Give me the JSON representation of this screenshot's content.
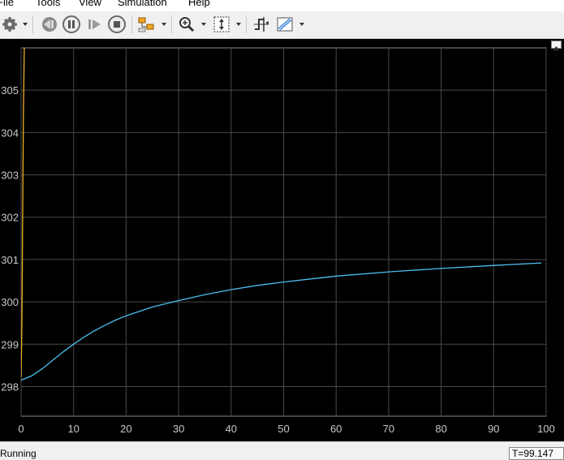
{
  "menu": {
    "items": [
      "File",
      "Tools",
      "View",
      "Simulation",
      "Help"
    ]
  },
  "toolbar": {
    "icons": [
      "settings-icon",
      "step-back-icon",
      "pause-icon",
      "step-forward-icon",
      "stop-icon",
      "highlight-signal-icon",
      "zoom-icon",
      "autoscale-icon",
      "triggers-icon",
      "cursor-measurements-icon"
    ]
  },
  "colors": {
    "background": "#000000",
    "grid": "#4a4a4a",
    "axis_text": "#c8c8c8",
    "series_1": "#4dbeee",
    "series_2": "#edb120"
  },
  "chart_data": {
    "type": "line",
    "title": "",
    "xlabel": "",
    "ylabel": "",
    "xlim": [
      0,
      100
    ],
    "ylim": [
      297.3,
      306
    ],
    "xticks": [
      0,
      10,
      20,
      30,
      40,
      50,
      60,
      70,
      80,
      90,
      100
    ],
    "yticks": [
      298,
      299,
      300,
      301,
      302,
      303,
      304,
      305
    ],
    "grid": true,
    "series": [
      {
        "color": "#4dbeee",
        "x": [
          0,
          2,
          4,
          6,
          8,
          10,
          12,
          14,
          16,
          18,
          20,
          25,
          30,
          35,
          40,
          45,
          50,
          60,
          70,
          80,
          90,
          99.1
        ],
        "y": [
          298.15,
          298.25,
          298.42,
          298.62,
          298.82,
          299.0,
          299.17,
          299.32,
          299.45,
          299.57,
          299.67,
          299.88,
          300.03,
          300.17,
          300.29,
          300.39,
          300.47,
          300.61,
          300.71,
          300.79,
          300.86,
          300.92
        ]
      },
      {
        "color": "#edb120",
        "x": [
          0,
          0.15,
          0.3,
          0.45,
          0.6
        ],
        "y": [
          298.2,
          299.5,
          302.0,
          304.5,
          306.0
        ]
      }
    ]
  },
  "status": {
    "text": "Running",
    "time": "T=99.147"
  }
}
